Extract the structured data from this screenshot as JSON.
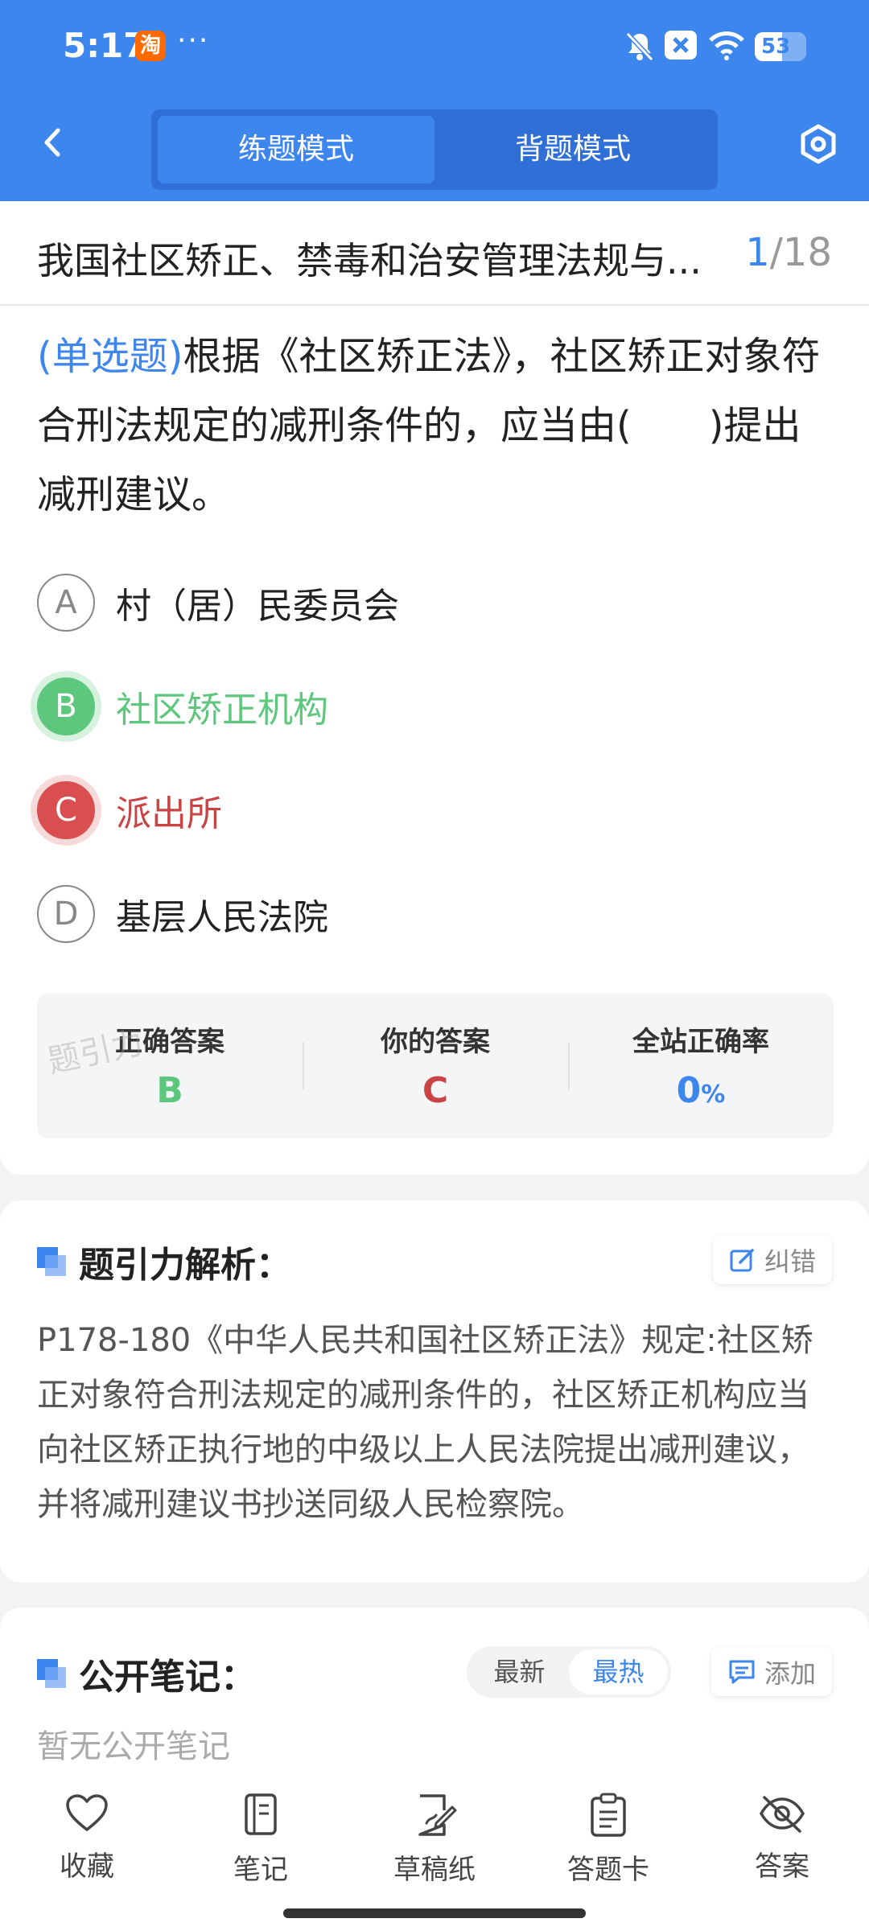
{
  "status_bar": {
    "time": "5:17",
    "battery": "53",
    "battery_level": 0.53,
    "app_icon": "淘",
    "more": "···"
  },
  "nav": {
    "modes": [
      {
        "label": "练题模式",
        "active": true
      },
      {
        "label": "背题模式",
        "active": false
      }
    ]
  },
  "question_header": {
    "title": "我国社区矫正、禁毒和治安管理法规与...",
    "current": "1",
    "total": "/18"
  },
  "question": {
    "type_tag": "(单选题)",
    "text": "根据《社区矫正法》，社区矫正对象符合刑法规定的减刑条件的，应当由(　　)提出减刑建议。"
  },
  "options": [
    {
      "letter": "A",
      "text": "村（居）民委员会",
      "state": "normal"
    },
    {
      "letter": "B",
      "text": "社区矫正机构",
      "state": "correct"
    },
    {
      "letter": "C",
      "text": "派出所",
      "state": "wrong"
    },
    {
      "letter": "D",
      "text": "基层人民法院",
      "state": "normal"
    }
  ],
  "answer_summary": {
    "correct_label": "正确答案",
    "correct_value": "B",
    "your_label": "你的答案",
    "your_value": "C",
    "rate_label": "全站正确率",
    "rate_value": "0",
    "rate_unit": "%",
    "watermark": "题引力"
  },
  "analysis": {
    "title": "题引力解析：",
    "report_label": "纠错",
    "text": "P178-180《中华人民共和国社区矫正法》规定:社区矫正对象符合刑法规定的减刑条件的，社区矫正机构应当向社区矫正执行地的中级以上人民法院提出减刑建议，并将减刑建议书抄送同级人民检察院。"
  },
  "notes": {
    "title": "公开笔记：",
    "sort_newest": "最新",
    "sort_hot": "最热",
    "add_label": "添加",
    "empty": "暂无公开笔记"
  },
  "toolbar": [
    {
      "label": "收藏",
      "icon": "heart-icon"
    },
    {
      "label": "笔记",
      "icon": "notebook-icon"
    },
    {
      "label": "草稿纸",
      "icon": "draft-icon"
    },
    {
      "label": "答题卡",
      "icon": "clipboard-icon"
    },
    {
      "label": "答案",
      "icon": "eye-off-icon"
    }
  ],
  "colors": {
    "primary": "#3d86ee",
    "correct": "#5dc77d",
    "wrong": "#c94545"
  }
}
